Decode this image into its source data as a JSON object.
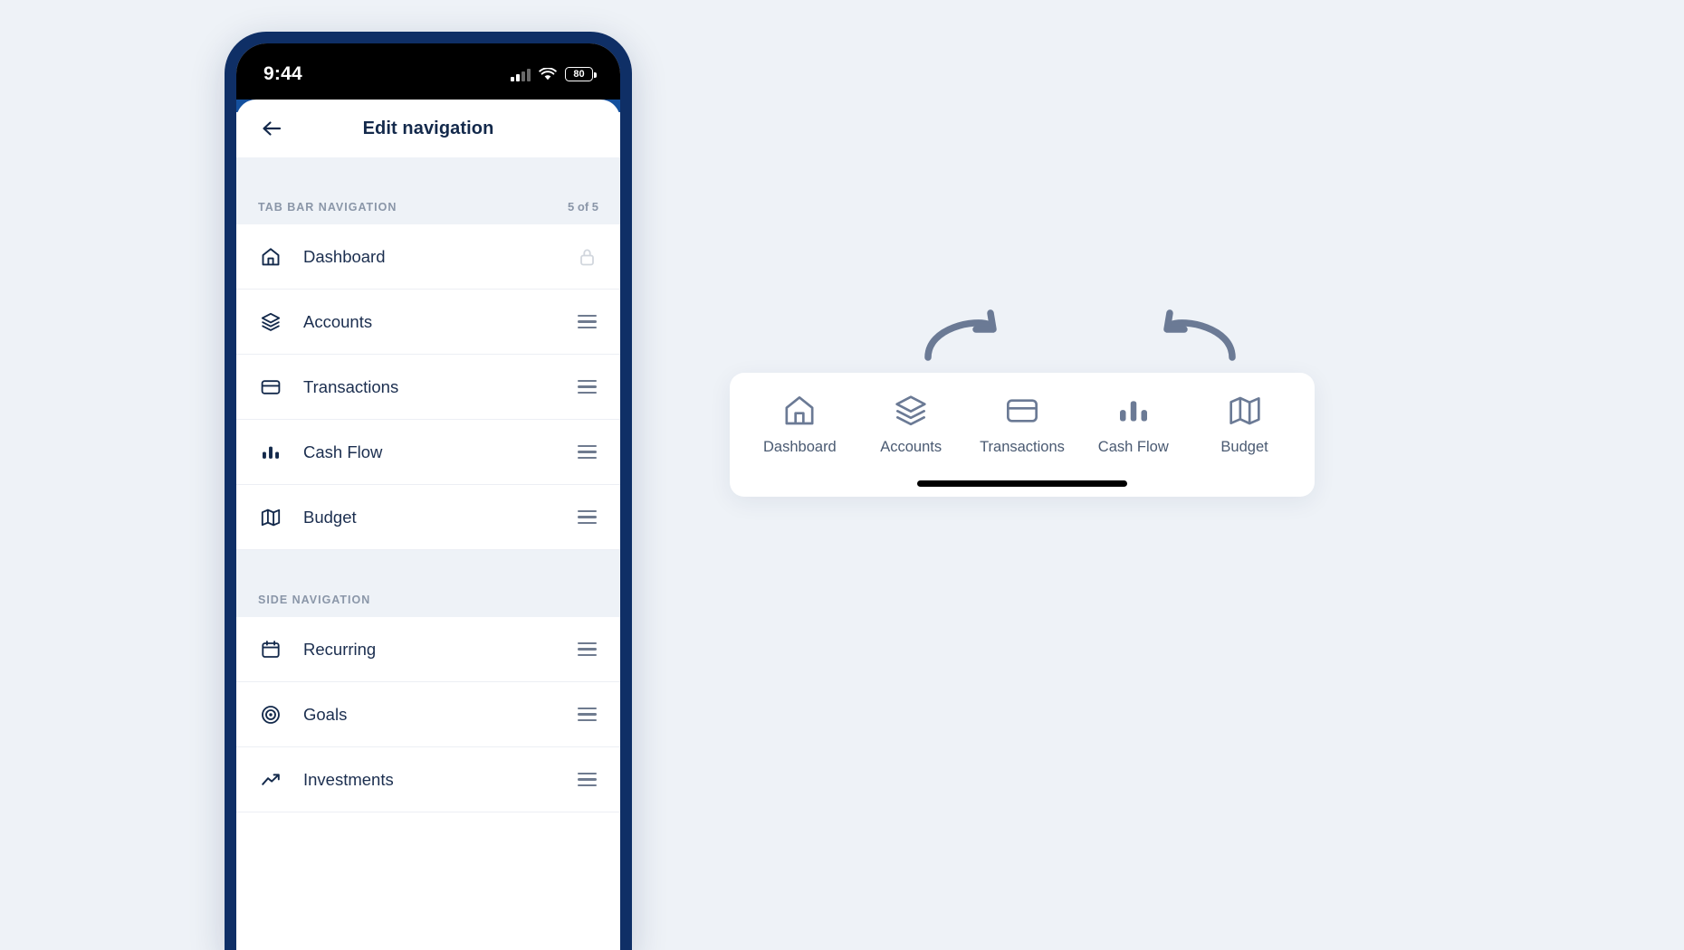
{
  "status_bar": {
    "time": "9:44",
    "battery_level": "80",
    "signal_icon": "cellular-signal-icon",
    "wifi_icon": "wifi-icon",
    "battery_icon": "battery-icon"
  },
  "app_bar": {
    "back_icon": "arrow-left-icon",
    "title": "Edit navigation"
  },
  "sections": [
    {
      "id": "tab-bar-navigation",
      "label": "TAB BAR NAVIGATION",
      "count": "5 of 5",
      "items": [
        {
          "label": "Dashboard",
          "icon": "home-icon",
          "trailing": "lock-icon"
        },
        {
          "label": "Accounts",
          "icon": "layers-icon",
          "trailing": "drag-handle-icon"
        },
        {
          "label": "Transactions",
          "icon": "credit-card-icon",
          "trailing": "drag-handle-icon"
        },
        {
          "label": "Cash Flow",
          "icon": "bar-chart-icon",
          "trailing": "drag-handle-icon"
        },
        {
          "label": "Budget",
          "icon": "map-icon",
          "trailing": "drag-handle-icon"
        }
      ]
    },
    {
      "id": "side-navigation",
      "label": "SIDE NAVIGATION",
      "count": "",
      "items": [
        {
          "label": "Recurring",
          "icon": "calendar-icon",
          "trailing": "drag-handle-icon"
        },
        {
          "label": "Goals",
          "icon": "target-icon",
          "trailing": "drag-handle-icon"
        },
        {
          "label": "Investments",
          "icon": "trending-up-icon",
          "trailing": "drag-handle-icon"
        }
      ]
    }
  ],
  "preview": {
    "redo_icon": "redo-arrow-icon",
    "undo_icon": "undo-arrow-icon",
    "tabs": [
      {
        "label": "Dashboard",
        "icon": "home-icon"
      },
      {
        "label": "Accounts",
        "icon": "layers-icon"
      },
      {
        "label": "Transactions",
        "icon": "credit-card-icon"
      },
      {
        "label": "Cash Flow",
        "icon": "bar-chart-icon"
      },
      {
        "label": "Budget",
        "icon": "map-icon"
      }
    ]
  },
  "colors": {
    "page_background": "#eef2f7",
    "phone_frame": "#0f2f66",
    "accent_blue": "#14509e",
    "text_primary": "#1b2e4f",
    "text_muted": "#8a96a8",
    "icon_preview": "#6b7a95"
  }
}
